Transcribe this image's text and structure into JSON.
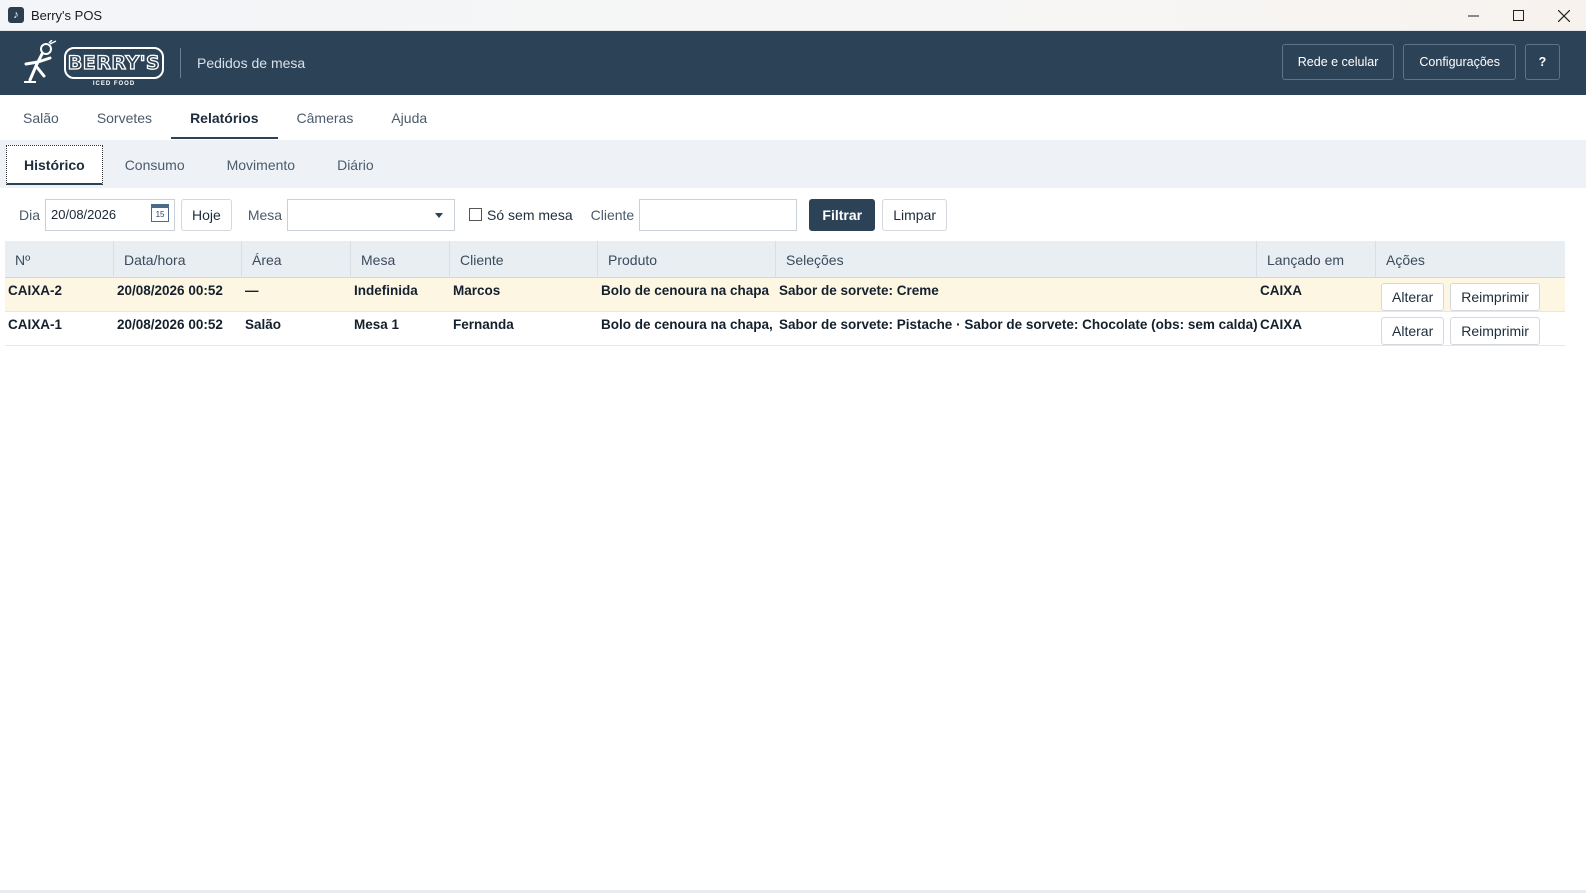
{
  "window": {
    "title": "Berry's POS"
  },
  "header": {
    "logo_text": "BERRY'S",
    "logo_sub": "ICED FOOD",
    "subtitle": "Pedidos de mesa",
    "buttons": {
      "network": "Rede e celular",
      "settings": "Configurações",
      "help": "?"
    }
  },
  "main_tabs": [
    "Salão",
    "Sorvetes",
    "Relatórios",
    "Câmeras",
    "Ajuda"
  ],
  "main_tab_active": "Relatórios",
  "sub_tabs": [
    "Histórico",
    "Consumo",
    "Movimento",
    "Diário"
  ],
  "sub_tab_active": "Histórico",
  "filters": {
    "day_label": "Dia",
    "day_value": "20/08/2026",
    "calendar_day": "15",
    "today_button": "Hoje",
    "table_label": "Mesa",
    "table_value": "",
    "no_table_label": "Só sem mesa",
    "no_table_checked": false,
    "client_label": "Cliente",
    "client_value": "",
    "filter_button": "Filtrar",
    "clear_button": "Limpar"
  },
  "table": {
    "headers": [
      "Nº",
      "Data/hora",
      "Área",
      "Mesa",
      "Cliente",
      "Produto",
      "Seleções",
      "Lançado em",
      "Ações"
    ],
    "rows": [
      {
        "num": "CAIXA-2",
        "datetime": "20/08/2026 00:52",
        "area": "—",
        "table": "Indefinida",
        "client": "Marcos",
        "product": "Bolo de cenoura na chapa",
        "selections": "Sabor de sorvete: Creme",
        "launched": "CAIXA",
        "edit": "Alterar",
        "reprint": "Reimprimir",
        "highlighted": true
      },
      {
        "num": "CAIXA-1",
        "datetime": "20/08/2026 00:52",
        "area": "Salão",
        "table": "Mesa 1",
        "client": "Fernanda",
        "product": "Bolo de cenoura na chapa, I",
        "selections": "Sabor de sorvete: Pistache · Sabor de sorvete: Chocolate (obs: sem calda)",
        "launched": "CAIXA",
        "edit": "Alterar",
        "reprint": "Reimprimir",
        "highlighted": false
      }
    ]
  },
  "colors": {
    "header_bg": "#2c4357",
    "accent": "#2c4357",
    "row_highlight": "#fdf6e3",
    "subtabs_bg": "#eef2f6"
  }
}
